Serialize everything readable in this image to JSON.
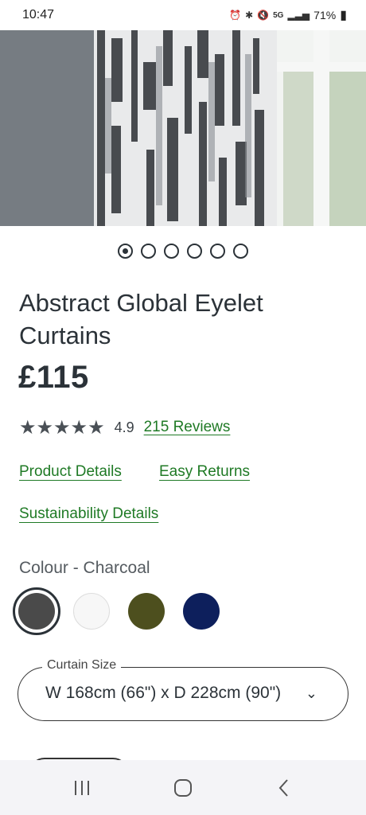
{
  "status_bar": {
    "time": "10:47",
    "battery": "71%",
    "network": "5G"
  },
  "gallery": {
    "slide_count": 6,
    "active_index": 0
  },
  "product": {
    "title": "Abstract Global Eyelet Curtains",
    "price": "£115",
    "stars": "★★★★★",
    "rating": "4.9",
    "reviews_link": "215 Reviews",
    "rating_fraction": 0.98
  },
  "links": {
    "product_details": "Product Details",
    "easy_returns": "Easy Returns",
    "sustainability": "Sustainability Details"
  },
  "colour": {
    "label": "Colour - Charcoal",
    "selected": "Charcoal",
    "swatches": [
      {
        "color": "#4a4a4a"
      },
      {
        "color": "#f7f7f7"
      },
      {
        "color": "#4d4f1e"
      },
      {
        "color": "#0d1f5c"
      }
    ]
  },
  "size": {
    "label": "Curtain Size",
    "value": "W 168cm (66\") x D 228cm (90\")"
  },
  "nav_bar": {
    "icons": [
      "recent-apps-icon",
      "home-icon",
      "back-icon"
    ]
  }
}
